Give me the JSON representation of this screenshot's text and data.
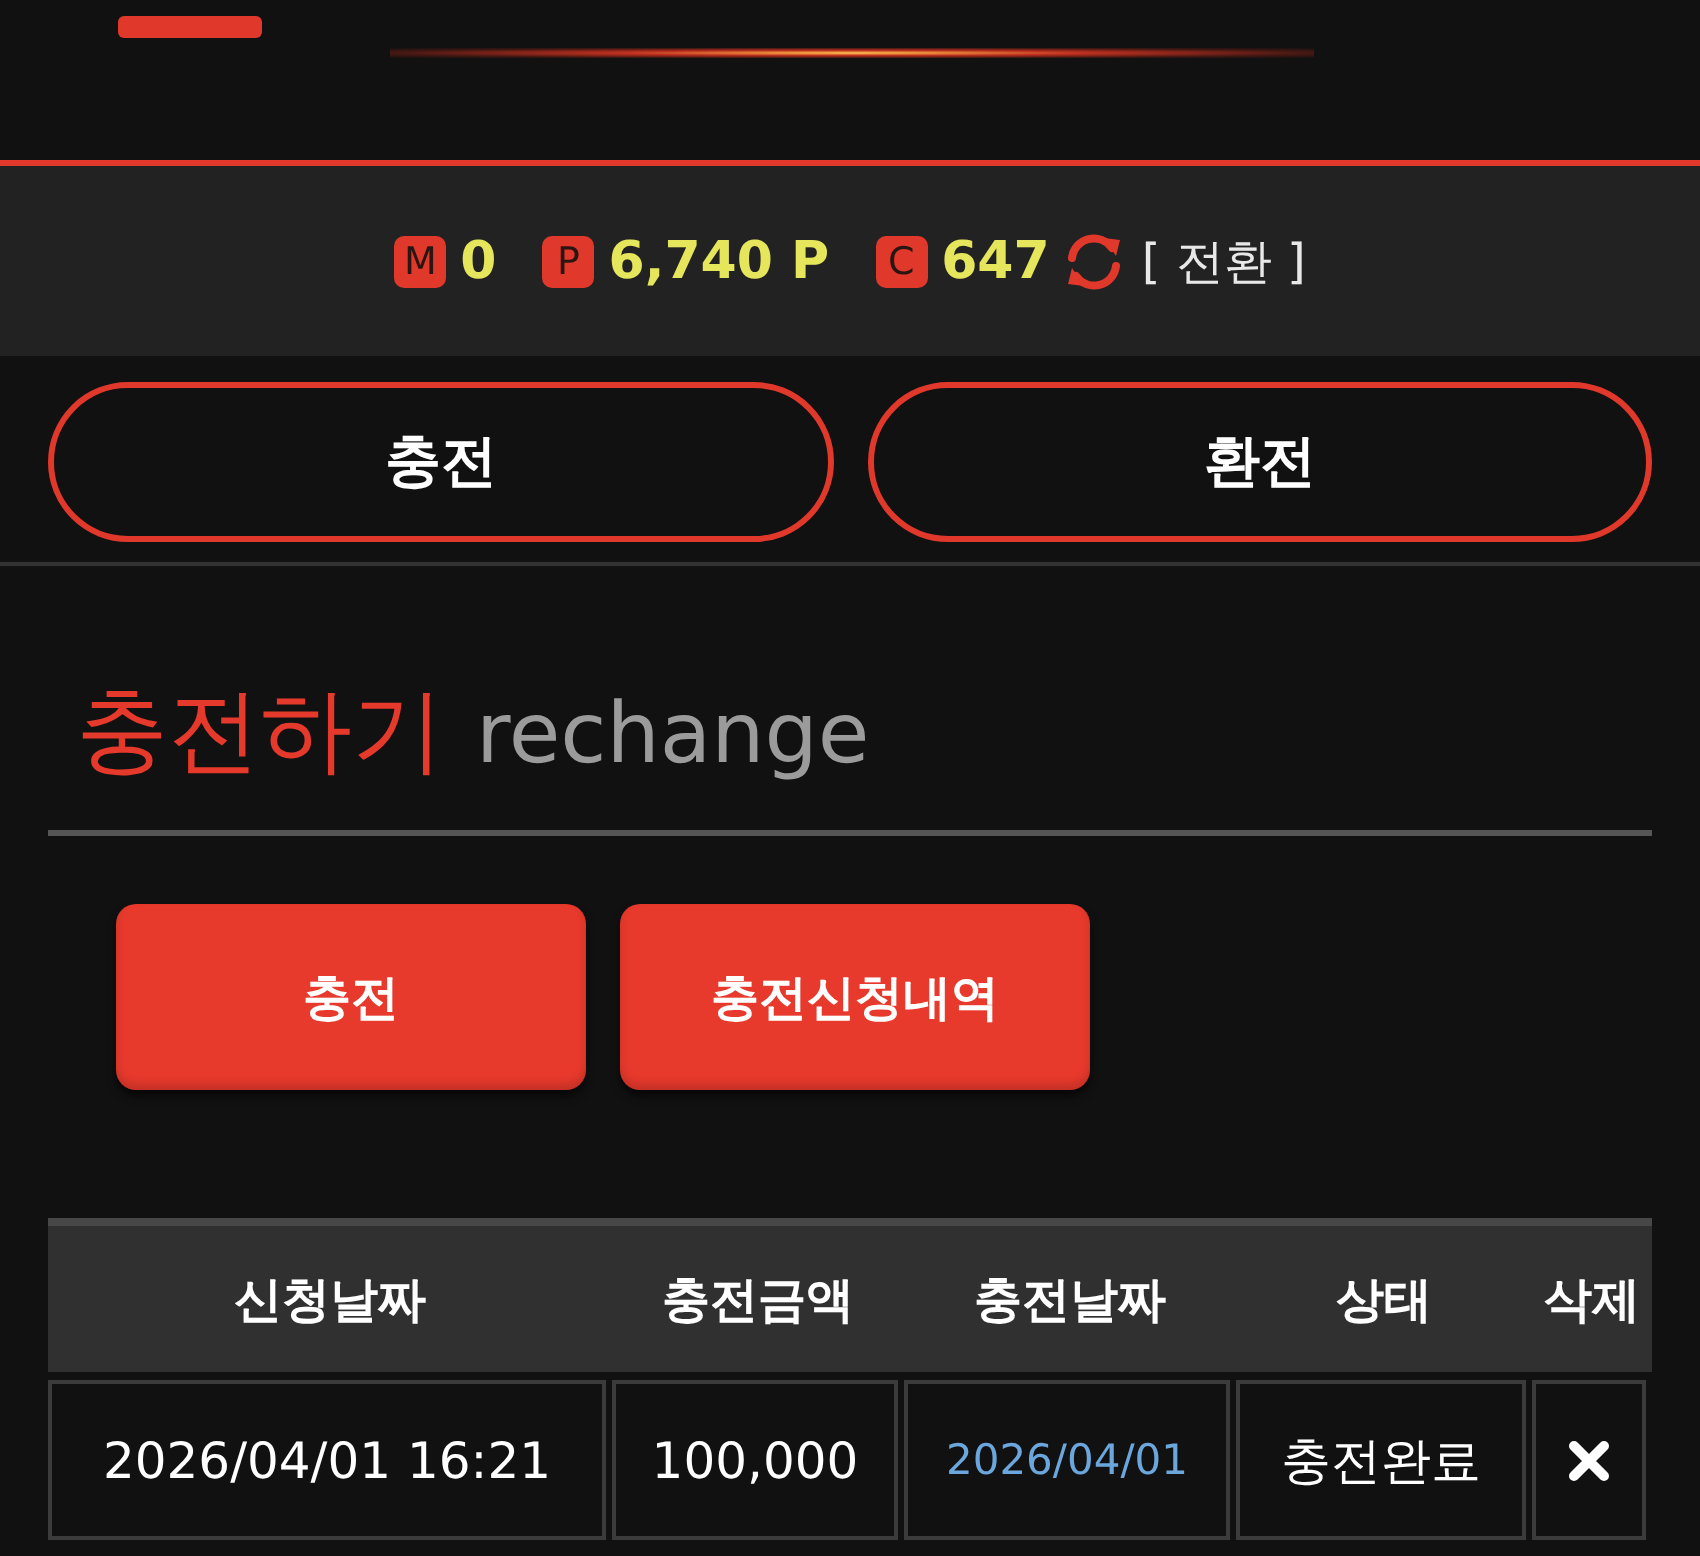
{
  "balance": {
    "items": [
      {
        "badge": "M",
        "value": "0"
      },
      {
        "badge": "P",
        "value": "6,740 P"
      },
      {
        "badge": "C",
        "value": "647"
      }
    ],
    "convert_link": "[ 전환 ]"
  },
  "nav_buttons": [
    "충전",
    "환전"
  ],
  "section": {
    "title": "충전하기",
    "subtitle": "rechange"
  },
  "actions": [
    "충전",
    "충전신청내역"
  ],
  "table": {
    "columns": [
      "신청날짜",
      "충전금액",
      "충전날짜",
      "상태",
      "삭제"
    ],
    "rows": [
      {
        "cells": [
          "2026/04/01 16:21",
          "100,000",
          "2026/04/01",
          "충전완료"
        ]
      }
    ]
  }
}
